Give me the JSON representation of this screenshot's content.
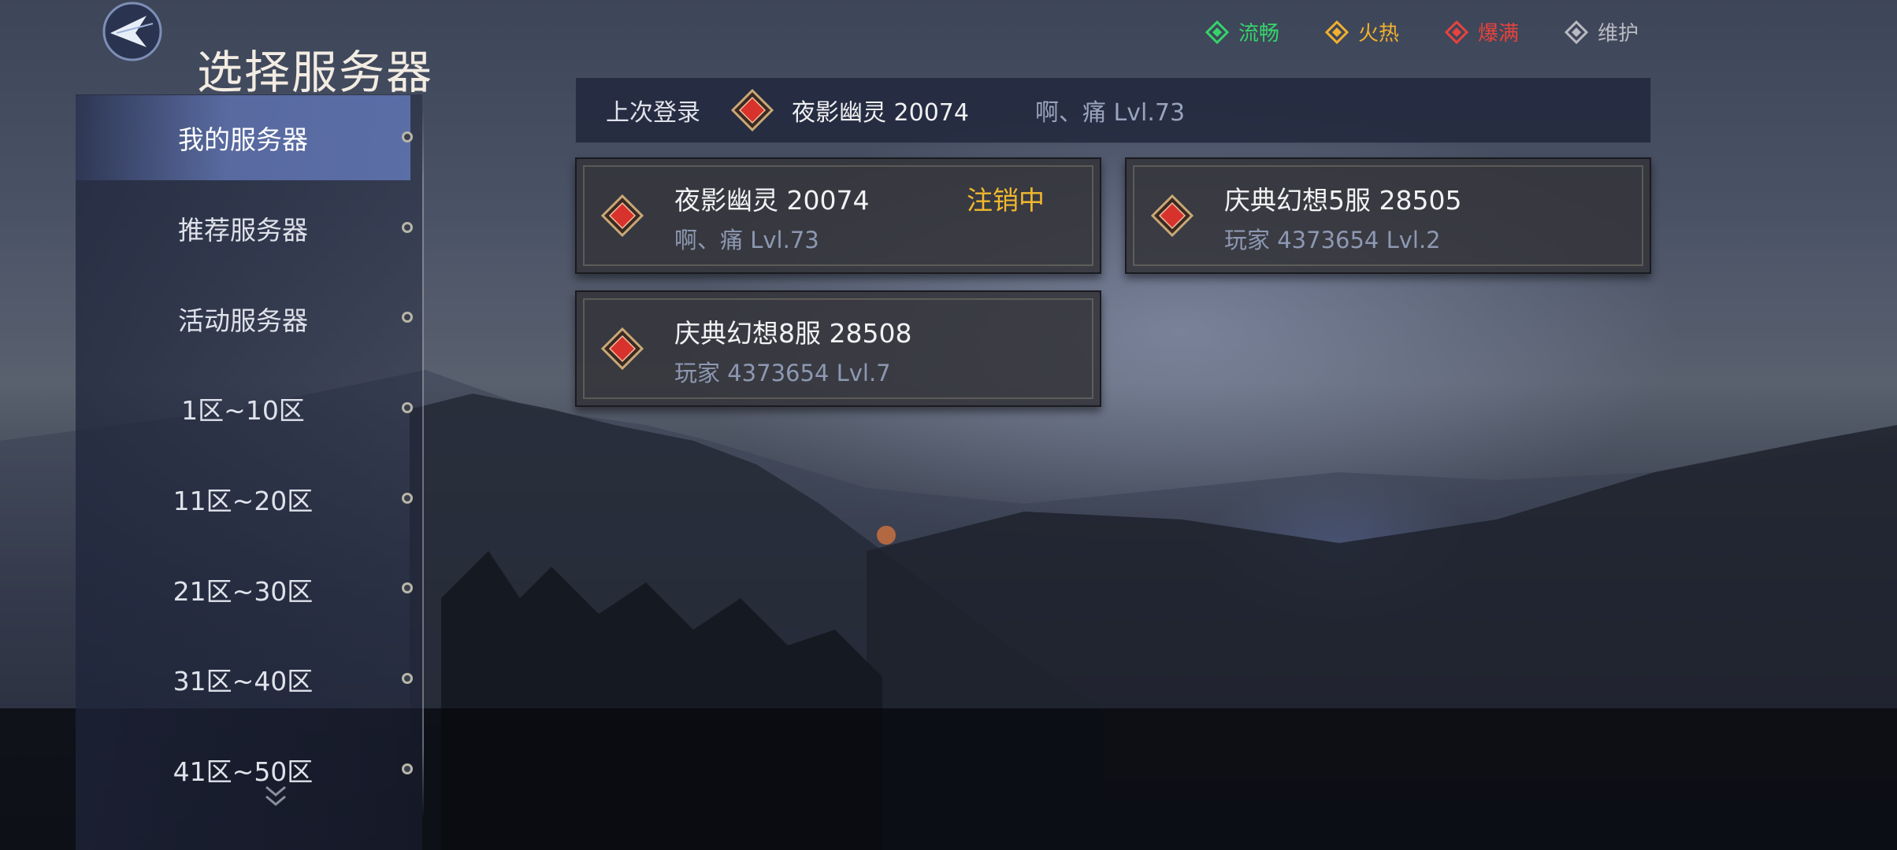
{
  "header": {
    "title": "选择服务器",
    "back_icon": "back-arrow-icon"
  },
  "legend": [
    {
      "label": "流畅",
      "color": "#35d46a"
    },
    {
      "label": "火热",
      "color": "#f2b02e"
    },
    {
      "label": "爆满",
      "color": "#e8433c"
    },
    {
      "label": "维护",
      "color": "#b9bbc2"
    }
  ],
  "sidebar": {
    "items": [
      {
        "label": "我的服务器",
        "active": true
      },
      {
        "label": "推荐服务器",
        "active": false
      },
      {
        "label": "活动服务器",
        "active": false
      },
      {
        "label": "1区~10区",
        "active": false
      },
      {
        "label": "11区~20区",
        "active": false
      },
      {
        "label": "21区~30区",
        "active": false
      },
      {
        "label": "31区~40区",
        "active": false
      },
      {
        "label": "41区~50区",
        "active": false
      }
    ],
    "scroll_icon": "chevron-double-down-icon"
  },
  "last_login": {
    "label": "上次登录",
    "server": "夜影幽灵 20074",
    "character": "啊、痛 Lvl.73",
    "status": "爆满"
  },
  "servers": [
    {
      "name": "夜影幽灵 20074",
      "character": "啊、痛 Lvl.73",
      "tag": "注销中",
      "status": "爆满"
    },
    {
      "name": "庆典幻想5服 28505",
      "character": "玩家 4373654 Lvl.2",
      "tag": "",
      "status": "爆满"
    },
    {
      "name": "庆典幻想8服 28508",
      "character": "玩家 4373654 Lvl.7",
      "tag": "",
      "status": "爆满"
    }
  ],
  "colors": {
    "tag_text": "#f2b92e",
    "active_tab": "#5f73af"
  }
}
